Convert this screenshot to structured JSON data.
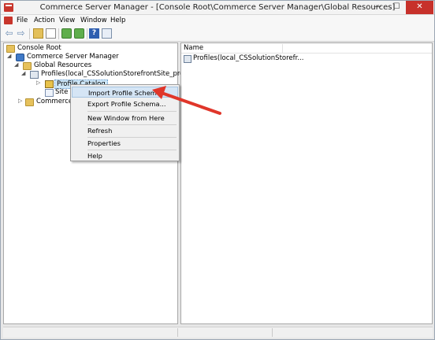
{
  "window": {
    "title": "Commerce Server Manager - [Console Root\\Commerce Server Manager\\Global Resources]",
    "minimize": "—",
    "maximize": "☐",
    "close": "✕"
  },
  "menubar": {
    "items": [
      {
        "label": "File"
      },
      {
        "label": "Action"
      },
      {
        "label": "View"
      },
      {
        "label": "Window"
      },
      {
        "label": "Help"
      }
    ]
  },
  "toolbar": {
    "back": "⇦",
    "forward": "⇨",
    "help": "?"
  },
  "tree": {
    "root": "Console Root",
    "csm": "Commerce Server Manager",
    "global_resources": "Global Resources",
    "profiles": "Profiles(local_CSSolutionStorefrontSite_profiles)",
    "profile_catalog": "Profile Catalog",
    "site_terms": "Site T",
    "commerce_sites": "Commerce S",
    "expand_open": "◢",
    "expand_closed": "▷"
  },
  "list": {
    "column_name": "Name",
    "rows": [
      {
        "label": "Profiles(local_CSSolutionStorefr..."
      }
    ]
  },
  "context_menu": {
    "items": [
      {
        "label": "Import Profile Schema..."
      },
      {
        "label": "Export Profile Schema..."
      },
      {
        "label": "New Window from Here"
      },
      {
        "label": "Refresh"
      },
      {
        "label": "Properties"
      },
      {
        "label": "Help"
      }
    ]
  },
  "colors": {
    "callout_arrow": "#e0362a",
    "close_button": "#c7312b",
    "selection": "#cde6f7"
  }
}
